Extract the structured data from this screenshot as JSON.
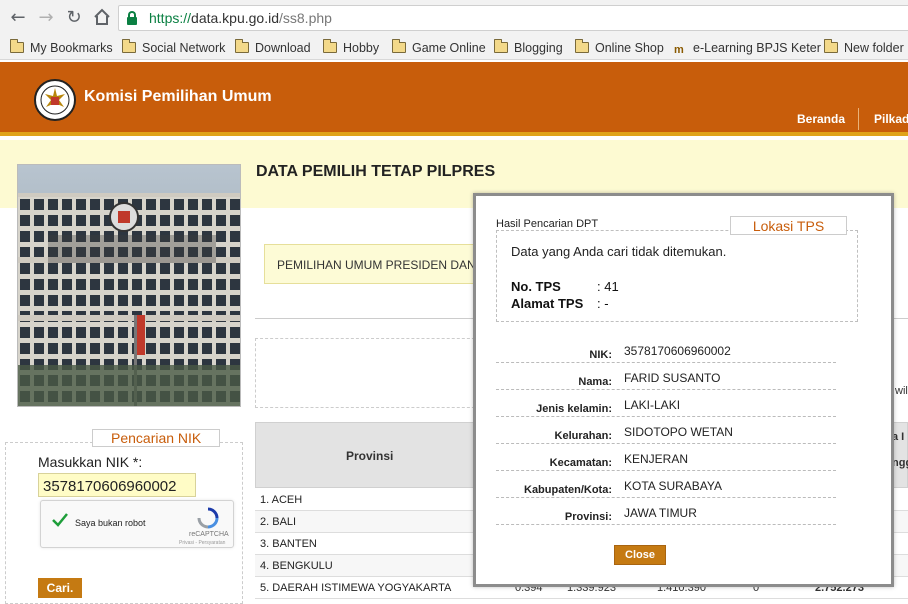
{
  "browser": {
    "url_scheme": "https://",
    "url_host": "data.kpu.go.id",
    "url_path": "/ss8.php",
    "bookmarks": [
      "My Bookmarks",
      "Social Network",
      "Download",
      "Hobby",
      "Game Online",
      "Blogging",
      "Online Shop",
      "e-Learning BPJS Keter",
      "New folder"
    ]
  },
  "site": {
    "title": "Komisi Pemilihan Umum",
    "nav": [
      "Beranda",
      "Pilkad"
    ]
  },
  "page": {
    "heading": "DATA PEMILIH TETAP PILPRES",
    "notice": "PEMILIHAN UMUM PRESIDEN DAN",
    "right_fragment": "wil"
  },
  "province_table": {
    "header": "Provinsi",
    "header_fragments": [
      "a I",
      "ngg"
    ],
    "rows": [
      "1. ACEH",
      "2. BALI",
      "3. BANTEN",
      "4. BENGKULU",
      "5. DAERAH ISTIMEWA YOGYAKARTA"
    ],
    "last_row_values": [
      "0.394",
      "1.339.923",
      "1.410.390",
      "0",
      "2.752.273"
    ]
  },
  "search": {
    "legend": "Pencarian NIK",
    "label": "Masukkan NIK *:",
    "value": "3578170606960002",
    "captcha_text": "Saya bukan robot",
    "captcha_brand": "reCAPTCHA",
    "captcha_privacy": "Privasi - Persyaratan",
    "button": "Cari."
  },
  "modal": {
    "subtitle": "Hasil Pencarian DPT",
    "tps_legend": "Lokasi TPS",
    "not_found": "Data yang Anda cari tidak ditemukan.",
    "no_tps_label": "No. TPS",
    "no_tps_value": ":   41",
    "alamat_label": "Alamat TPS",
    "alamat_value": ":   -",
    "fields": [
      {
        "label": "NIK:",
        "value": "3578170606960002"
      },
      {
        "label": "Nama:",
        "value": "FARID SUSANTO"
      },
      {
        "label": "Jenis kelamin:",
        "value": "LAKI-LAKI"
      },
      {
        "label": "Kelurahan:",
        "value": "SIDOTOPO WETAN"
      },
      {
        "label": "Kecamatan:",
        "value": "KENJERAN"
      },
      {
        "label": "Kabupaten/Kota:",
        "value": "KOTA SURABAYA"
      },
      {
        "label": "Provinsi:",
        "value": "JAWA TIMUR"
      }
    ],
    "close": "Close"
  },
  "colors": {
    "header_orange": "#c85d0b",
    "accent_gold": "#e0a31a",
    "button_orange": "#c57a12",
    "secure_green": "#0b8043"
  }
}
